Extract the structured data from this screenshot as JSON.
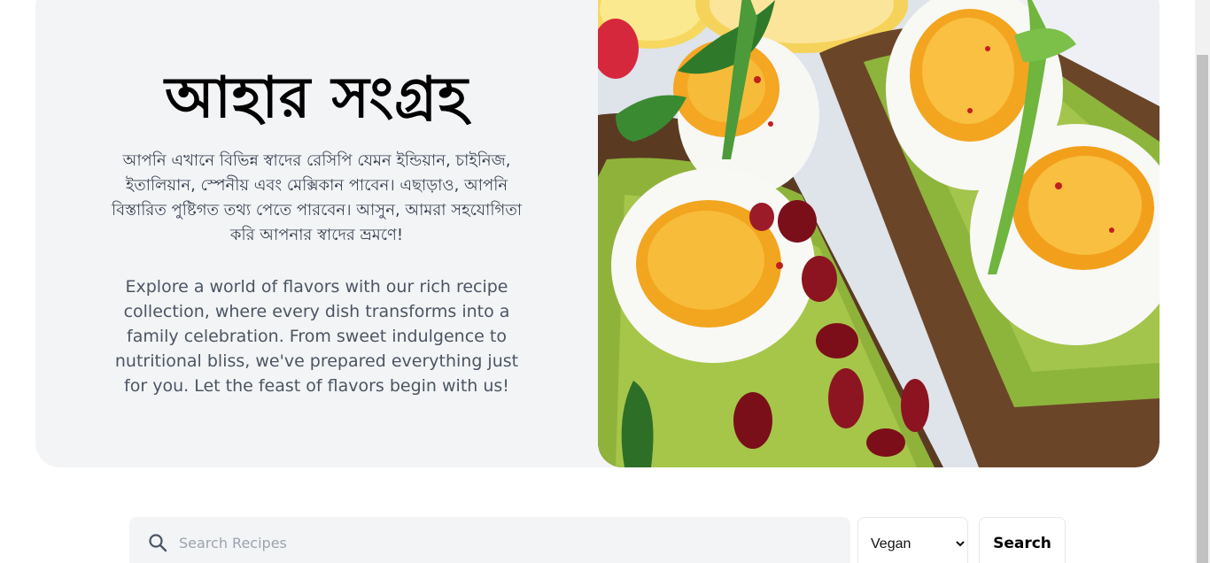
{
  "hero": {
    "title": "আহার সংগ্রহ",
    "description_bn": "আপনি এখানে বিভিন্ন স্বাদের রেসিপি যেমন ইন্ডিয়ান, চাইনিজ, ইতালিয়ান, স্পেনীয় এবং মেক্সিকান পাবেন। এছাড়াও, আপনি বিস্তারিত পুষ্টিগত তথ্য পেতে পারবেন। আসুন, আমরা সহযোগিতা করি আপনার স্বাদের ভ্রমণে!",
    "description_en": "Explore a world of flavors with our rich recipe collection, where every dish transforms into a family celebration. From sweet indulgence to nutritional bliss, we've prepared everything just for you. Let the feast of flavors begin with us!"
  },
  "search": {
    "placeholder": "Search Recipes",
    "icon": "search-icon",
    "diet_selected": "Vegan",
    "button_label": "Search"
  },
  "colors": {
    "hero_bg": "#f3f4f6",
    "title": "#000000",
    "body_text": "#374151",
    "avocado": "#8fb33a",
    "yolk": "#f5a623",
    "bread": "#5a3b22"
  }
}
